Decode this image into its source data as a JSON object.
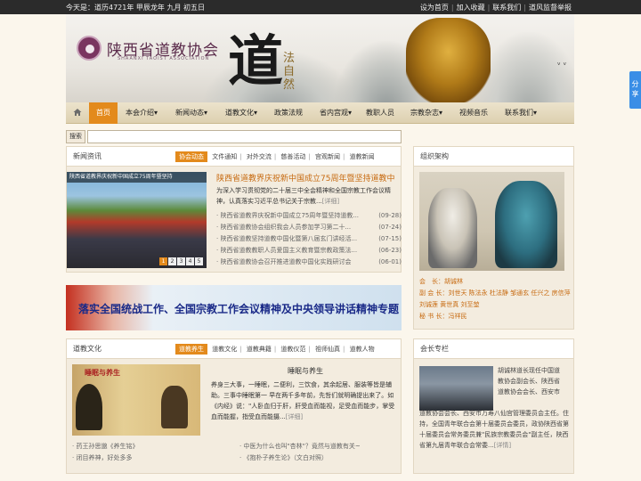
{
  "topbar": {
    "date": "今天是：道历4721年 甲辰龙年 九月 初五日",
    "links": [
      "设为首页",
      "加入收藏",
      "联系我们",
      "道风监督举报"
    ]
  },
  "banner": {
    "org_name": "陕西省道教协会",
    "org_en": "SHAANXI TAOIST ASSOCIATION",
    "calligraphy": "道",
    "motto": "法自然"
  },
  "nav": {
    "items": [
      "首页",
      "本会介绍▾",
      "新闻动态▾",
      "道教文化▾",
      "政策法规",
      "省内宫观▾",
      "教职人员",
      "宗教杂志▾",
      "视频音乐",
      "联系我们▾"
    ]
  },
  "search": {
    "label": "搜索"
  },
  "news": {
    "title": "新闻资讯",
    "tabs": [
      "协会动态",
      "文件通知",
      "对外交流",
      "慈善活动",
      "宫观新闻",
      "道教新闻"
    ],
    "image_caption": "陕西省道教界庆祝新中国成立75周年暨坚持",
    "pager": [
      "1",
      "2",
      "3",
      "4",
      "5"
    ],
    "headline": "陕西省道教界庆祝新中国成立75周年暨坚持道教中",
    "summary": "为深入学习贯彻党的二十届三中全会精神和全国宗教工作会议精神，认真落实习近平总书记关于宗教...",
    "more": "[详细]",
    "list": [
      {
        "text": "· 陕西省道教界庆祝新中国成立75周年暨坚持道教...",
        "date": "(09-28)"
      },
      {
        "text": "· 陕西省道教协会组织我会人员参加学习第二十...",
        "date": "(07-24)"
      },
      {
        "text": "· 陕西省道教坚持道教中国化暨第八届玄门讲经活...",
        "date": "(07-15)"
      },
      {
        "text": "· 陕西省道教教职人员爱国主义教育暨宗教政策法...",
        "date": "(06-23)"
      },
      {
        "text": "· 陕西省道教协会召开推进道教中国化实践研讨会",
        "date": "(06-01)"
      }
    ]
  },
  "promo_banner": "落实全国统战工作、全国宗教工作会议精神及中央领导讲话精神专题",
  "culture": {
    "title": "道教文化",
    "tabs": [
      "道教养生",
      "道教文化",
      "道教典籍",
      "道教仪范",
      "祖师仙真",
      "道教人物"
    ],
    "image_title": "睡眠与养生",
    "article_title": "睡眠与养生",
    "summary": "养身三大事，一睡眠，二便利，三饮食，其余起居、服装等皆是辅助。三事中睡眠第一   早在两千多年前，先哲们就明确提出来了。如《内经》说：\"人卧血归于肝，肝受血而能视，足受血而能步，掌受血而能握，指受血而能摄...",
    "more": "[详细]",
    "list_left": [
      "· 药王孙思邈《养生铭》",
      "· 闭目养神，好处多多"
    ],
    "list_right": [
      "· 中医为什么也叫\"杏林\"？竟然与道教有关~",
      "· 《抱朴子养生论》（文白对照）"
    ]
  },
  "org": {
    "title": "组织架构",
    "rows": [
      {
        "key": "会　长：",
        "val": "胡诚林"
      },
      {
        "key": "副 会 长：",
        "val": "刘世天 陈法永 杜法静 邹通玄 任兴之 房信萍 刘诚莲 黄世真 刘至堃"
      },
      {
        "key": "秘 书 长：",
        "val": "冯祥民"
      }
    ]
  },
  "president": {
    "title": "会长专栏",
    "text_side": "胡诚林道长现任中国道教协会副会长、陕西省道教协会会长、西安市",
    "text_full": "道教协会会长、西安市万寿八仙宫管理委员会主任。住持，全国青年联合会第十届委员会委员，政协陕西省第十届委员会常务委员兼\"民族宗教委员会\"副主任，陕西省第九届青年联合会常委...",
    "more": "[详情]"
  },
  "share": {
    "label": "分享"
  }
}
